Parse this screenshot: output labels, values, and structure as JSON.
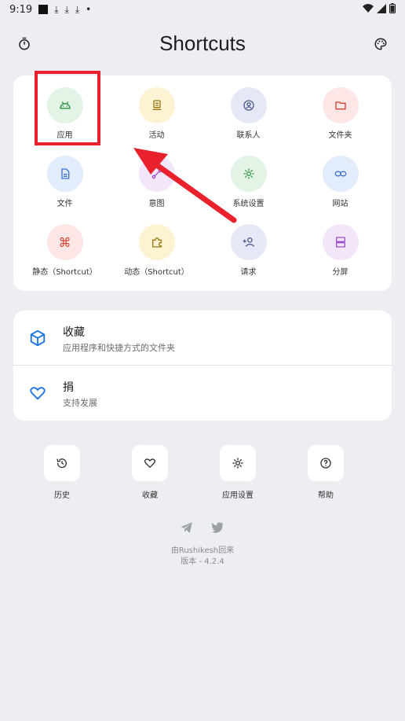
{
  "status_bar": {
    "time": "9:19"
  },
  "header": {
    "title": "Shortcuts"
  },
  "grid": [
    {
      "label": "应用",
      "icon": "android-icon",
      "bg": "#e3f4e6",
      "fg": "#3a9b4e"
    },
    {
      "label": "活动",
      "icon": "activity-icon",
      "bg": "#fdf3d3",
      "fg": "#9a7a12"
    },
    {
      "label": "联系人",
      "icon": "contact-icon",
      "bg": "#e5e8f6",
      "fg": "#4e5a8a"
    },
    {
      "label": "文件夹",
      "icon": "folder-icon",
      "bg": "#fde7e6",
      "fg": "#d04030"
    },
    {
      "label": "文件",
      "icon": "file-icon",
      "bg": "#e3ecfb",
      "fg": "#3d72d0"
    },
    {
      "label": "意图",
      "icon": "intent-icon",
      "bg": "#f3e6fb",
      "fg": "#9a4fc8"
    },
    {
      "label": "系统设置",
      "icon": "settings-icon",
      "bg": "#e3f4e6",
      "fg": "#3a9b4e"
    },
    {
      "label": "网站",
      "icon": "link-icon",
      "bg": "#e3ecfb",
      "fg": "#3d72d0"
    },
    {
      "label": "静态（Shortcut）",
      "icon": "command-icon",
      "bg": "#fde7e6",
      "fg": "#d04030"
    },
    {
      "label": "动态（Shortcut）",
      "icon": "puzzle-icon",
      "bg": "#fdf3d3",
      "fg": "#9a7a12"
    },
    {
      "label": "请求",
      "icon": "person-add-icon",
      "bg": "#e5e8f6",
      "fg": "#4e5a8a"
    },
    {
      "label": "分屏",
      "icon": "split-screen-icon",
      "bg": "#f3e6fb",
      "fg": "#9a4fc8"
    }
  ],
  "list": [
    {
      "title": "收藏",
      "subtitle": "应用程序和快捷方式的文件夹",
      "icon": "box-icon"
    },
    {
      "title": "捐",
      "subtitle": "支持发展",
      "icon": "heart-icon"
    }
  ],
  "bottom_actions": [
    {
      "label": "历史",
      "icon": "history-icon"
    },
    {
      "label": "收藏",
      "icon": "heart-icon"
    },
    {
      "label": "应用设置",
      "icon": "gear-icon"
    },
    {
      "label": "帮助",
      "icon": "help-icon"
    }
  ],
  "credit": {
    "line1": "由Rushikesh回来",
    "line2": "版本 - 4.2.4"
  },
  "colors": {
    "accent": "#1a73e8",
    "annotation": "#e8212d"
  }
}
